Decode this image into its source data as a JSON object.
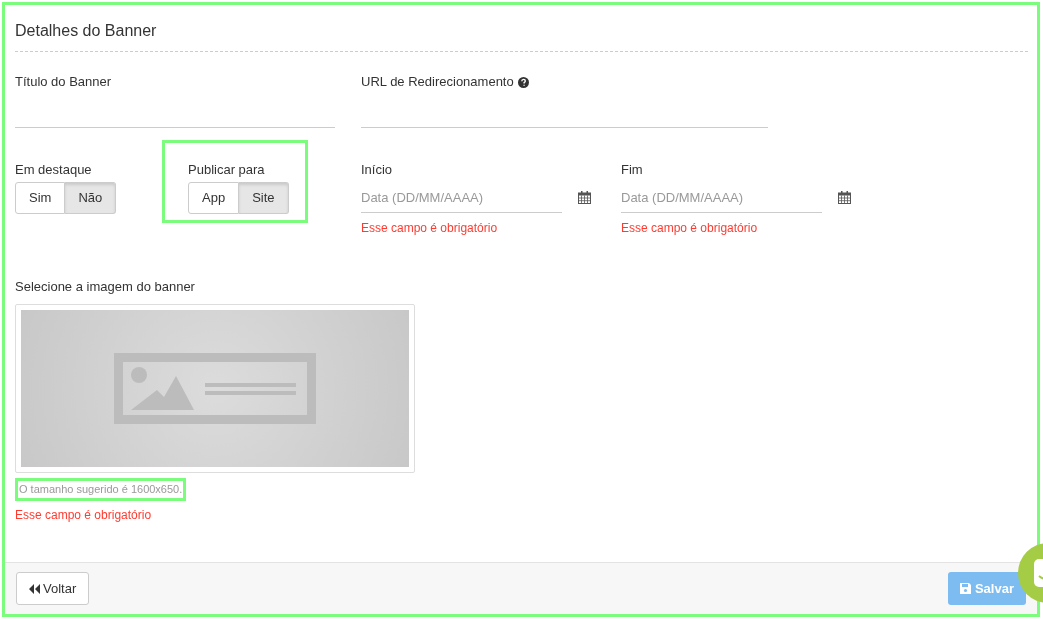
{
  "panel": {
    "title": "Detalhes do Banner"
  },
  "text_fields": [
    {
      "label": "Título do Banner",
      "help": false
    },
    {
      "label": "URL de Redirecionamento",
      "help": true
    }
  ],
  "toggles": [
    {
      "label": "Em destaque",
      "highlighted": false,
      "options": [
        {
          "label": "Sim",
          "selected": false
        },
        {
          "label": "Não",
          "selected": true
        }
      ]
    },
    {
      "label": "Publicar para",
      "highlighted": true,
      "options": [
        {
          "label": "App",
          "selected": false
        },
        {
          "label": "Site",
          "selected": true
        }
      ]
    }
  ],
  "date_fields": [
    {
      "label": "Início",
      "placeholder": "Data (DD/MM/AAAA)",
      "error": "Esse campo é obrigatório"
    },
    {
      "label": "Fim",
      "placeholder": "Data (DD/MM/AAAA)",
      "error": "Esse campo é obrigatório"
    }
  ],
  "image": {
    "label": "Selecione a imagem do banner",
    "hint": "O tamanho sugerido é 1600x650.",
    "hint_highlighted": true,
    "error": "Esse campo é obrigatório"
  },
  "footer": {
    "back_button": "Voltar",
    "save_button": {
      "label": "Salvar",
      "disabled": true
    }
  }
}
